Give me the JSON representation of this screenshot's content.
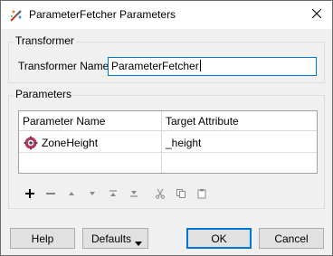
{
  "window": {
    "title": "ParameterFetcher Parameters"
  },
  "transformer": {
    "group_label": "Transformer",
    "name_label": "Transformer Name:",
    "name_value": "ParameterFetcher"
  },
  "parameters": {
    "group_label": "Parameters",
    "columns": [
      "Parameter Name",
      "Target Attribute"
    ],
    "rows": [
      {
        "icon": "parameter-icon",
        "name": "ZoneHeight",
        "target": "_height"
      }
    ]
  },
  "toolbar": {
    "icons": [
      "add-icon",
      "remove-icon",
      "move-up-icon",
      "move-down-icon",
      "move-to-top-icon",
      "move-to-bottom-icon",
      "cut-icon",
      "copy-icon",
      "paste-icon"
    ]
  },
  "buttons": {
    "help": "Help",
    "defaults": "Defaults",
    "ok": "OK",
    "cancel": "Cancel"
  },
  "colors": {
    "accent": "#0078d7",
    "disabled_icon": "#8a8a8a"
  }
}
